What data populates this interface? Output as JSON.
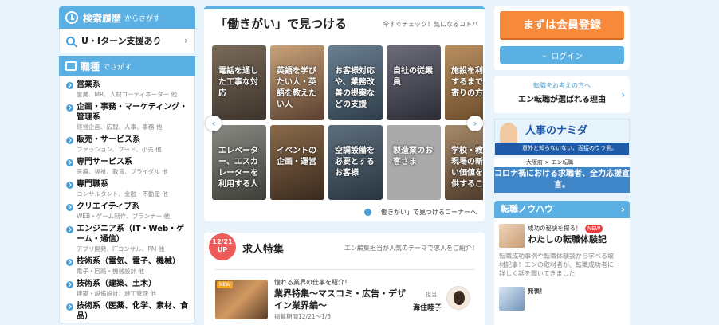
{
  "left": {
    "history": {
      "title": "検索履歴",
      "sub": "からさがす",
      "item": "U・Iターン支援あり"
    },
    "category": {
      "title": "職種",
      "sub": "でさがす",
      "items": [
        {
          "title": "営業系",
          "sub": "営業、MR、人材コーディネーター 他"
        },
        {
          "title": "企画・事務・マーケティング・管理系",
          "sub": "経営企画、広報、人事、事務 他"
        },
        {
          "title": "販売・サービス系",
          "sub": "ファッション、フード、小売 他"
        },
        {
          "title": "専門サービス系",
          "sub": "医療、福祉、教育、ブライダル 他"
        },
        {
          "title": "専門職系",
          "sub": "コンサルタント、金融・不動産 他"
        },
        {
          "title": "クリエイティブ系",
          "sub": "WEB・ゲーム制作、プランナー 他"
        },
        {
          "title": "エンジニア系（IT・Web・ゲーム・通信）",
          "sub": "アプリ開発、ITコンサル、PM 他"
        },
        {
          "title": "技術系（電気、電子、機械）",
          "sub": "電子・回路・機械設計 他"
        },
        {
          "title": "技術系（建築、土木）",
          "sub": "建築・設備設計、施工管理 他"
        },
        {
          "title": "技術系（医薬、化学、素材、食品）",
          "sub": ""
        }
      ]
    }
  },
  "center": {
    "work": {
      "title": "「働きがい」で見つける",
      "sub": "今すぐチェック！気になるコトバ",
      "tiles": [
        {
          "label": "電話を通した工事な対応"
        },
        {
          "label": "英語を学びたい人・英語を教えたい人"
        },
        {
          "label": "お客様対応や、業務改善の提案などの支援"
        },
        {
          "label": "自社の従業員"
        },
        {
          "label": "施設を利用するまで年寄りの方"
        },
        {
          "label": "エレベーター、エスカレーターを利用する人"
        },
        {
          "label": "イベントの企画・運営"
        },
        {
          "label": "空調設備を必要とするお客様"
        },
        {
          "label": "製造業のお客さま"
        },
        {
          "label": "学校・教育現場の新しい価値を提供すること"
        }
      ],
      "link": "「働きがい」で見つけるコーナーへ"
    },
    "job": {
      "badge_date": "12/21",
      "badge_text": "UP",
      "title": "求人特集",
      "sub": "エン編集担当が人気のテーマで求人をご紹介！",
      "card": {
        "thumb_tag": "NEW",
        "lead": "憧れる業界の仕事を紹介！",
        "headline": "業界特集〜マスコミ・広告・デザイン業界編〜",
        "period": "掲載期間12/21〜1/3",
        "role": "担当",
        "person": "海住睦子"
      }
    }
  },
  "right": {
    "register": "まずは会員登録",
    "login": "ログイン",
    "reason": {
      "sub": "転職をお考えの方へ",
      "title": "エン転職が選ばれる理由"
    },
    "banner1": {
      "title": "人事のナミダ",
      "bar": "意外と知らないない、面接のウラ側。"
    },
    "banner2": {
      "top": "大阪府 × エン転職",
      "main": "コロナ禍における求職者、全力応援宣言。"
    },
    "knowhow": {
      "title": "転職ノウハウ",
      "items": [
        {
          "lead": "成功の秘訣を探る！",
          "new": "NEW",
          "title": "わたしの転職体験記",
          "desc": "転職成功事例や転職体験談から学べる取材記事！エンの取材者が、転職成功者に詳しく話を聞いてきました"
        },
        {
          "lead": "発表！"
        }
      ]
    }
  }
}
